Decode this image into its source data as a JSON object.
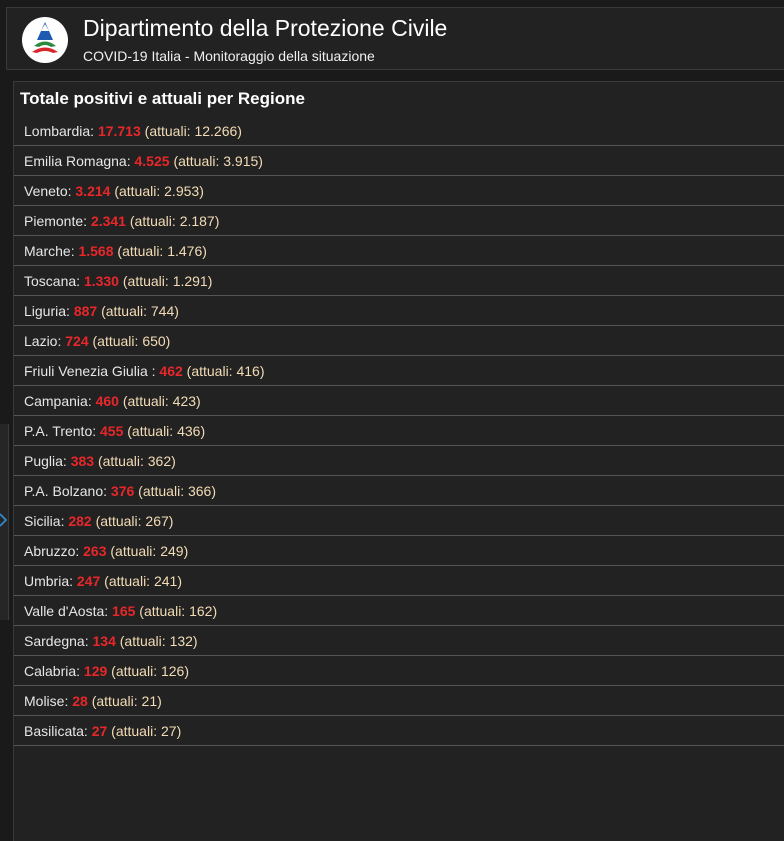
{
  "header": {
    "title": "Dipartimento della Protezione Civile",
    "subtitle": "COVID-19 Italia - Monitoraggio della situazione"
  },
  "panel": {
    "title": "Totale positivi e attuali per Regione",
    "regions": [
      {
        "name": "Lombardia",
        "total": "17.713",
        "current": "12.266"
      },
      {
        "name": "Emilia Romagna",
        "total": "4.525",
        "current": "3.915"
      },
      {
        "name": "Veneto",
        "total": "3.214",
        "current": "2.953"
      },
      {
        "name": "Piemonte",
        "total": "2.341",
        "current": "2.187"
      },
      {
        "name": "Marche",
        "total": "1.568",
        "current": "1.476"
      },
      {
        "name": "Toscana",
        "total": "1.330",
        "current": "1.291"
      },
      {
        "name": "Liguria",
        "total": "887",
        "current": "744"
      },
      {
        "name": "Lazio",
        "total": "724",
        "current": "650"
      },
      {
        "name": "Friuli Venezia Giulia ",
        "total": "462",
        "current": "416"
      },
      {
        "name": "Campania",
        "total": "460",
        "current": "423"
      },
      {
        "name": "P.A. Trento",
        "total": "455",
        "current": "436"
      },
      {
        "name": "Puglia",
        "total": "383",
        "current": "362"
      },
      {
        "name": "P.A. Bolzano",
        "total": "376",
        "current": "366"
      },
      {
        "name": "Sicilia",
        "total": "282",
        "current": "267"
      },
      {
        "name": "Abruzzo",
        "total": "263",
        "current": "249"
      },
      {
        "name": "Umbria",
        "total": "247",
        "current": "241"
      },
      {
        "name": "Valle d'Aosta",
        "total": "165",
        "current": "162"
      },
      {
        "name": "Sardegna",
        "total": "134",
        "current": "132"
      },
      {
        "name": "Calabria",
        "total": "129",
        "current": "126"
      },
      {
        "name": "Molise",
        "total": "28",
        "current": "21"
      },
      {
        "name": "Basilicata",
        "total": "27",
        "current": "27"
      }
    ]
  },
  "labels": {
    "current_prefix": "(attuali: ",
    "current_suffix": ")"
  },
  "colors": {
    "total_value": "#e8272a",
    "current_value": "#f3dcb5",
    "background": "#1a1a1a",
    "panel": "#222222"
  },
  "icons": {
    "logo": "protezione-civile-logo",
    "side_toggle": "chevron-right-icon"
  }
}
